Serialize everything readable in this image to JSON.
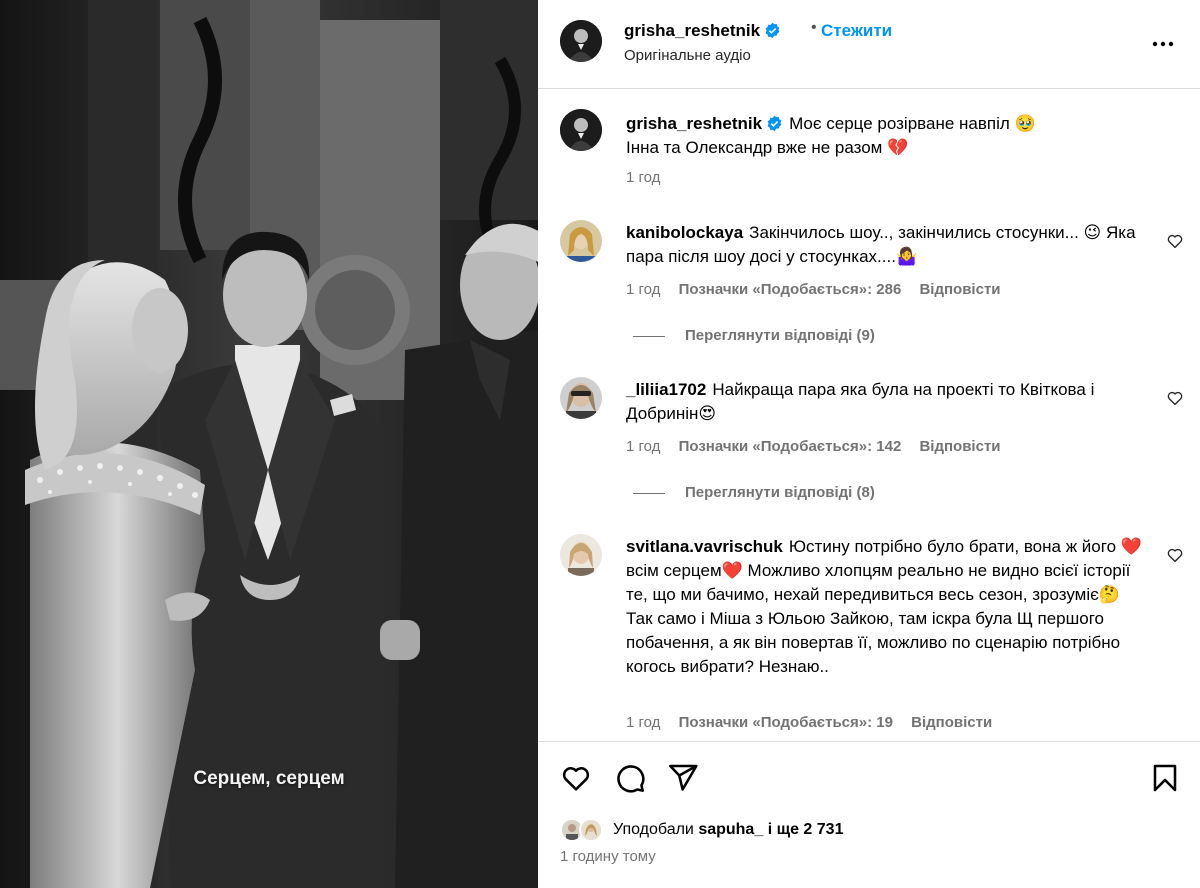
{
  "video": {
    "caption": "Серцем, серцем"
  },
  "header": {
    "username": "grisha_reshetnik",
    "separator": "•",
    "follow_label": "Стежити",
    "audio": "Оригінальне аудіо",
    "more_icon": "more-options-icon"
  },
  "post": {
    "username": "grisha_reshetnik",
    "text_line1": "Моє серце розірване навпіл 🥹",
    "text_line2": "Інна та Олександр вже не разом 💔",
    "time": "1 год"
  },
  "comments": [
    {
      "username": "kanibolockaya",
      "text": "Закінчилось шоу.., закінчились стосунки... 😉 Яка пара після шоу досі у стосунках....🤷‍♀️",
      "time": "1 год",
      "likes": "Позначки «Подобається»: 286",
      "reply": "Відповісти",
      "view_replies": "Переглянути відповіді (9)"
    },
    {
      "username": "_liliia1702",
      "text": "Найкраща пара яка була на проекті то Квіткова і Добринін😍",
      "time": "1 год",
      "likes": "Позначки «Подобається»: 142",
      "reply": "Відповісти",
      "view_replies": "Переглянути відповіді (8)"
    },
    {
      "username": "svitlana.vavrischuk",
      "text": "Юстину потрібно було брати, вона ж його ❤️всім серцем❤️ Можливо хлопцям реально не видно всієї історії те, що ми бачимо, нехай передивиться весь сезон, зрозуміє🤔 Так само і Міша з Юльою Зайкою, там іскра була Щ першого побачення, а як він повертав її, можливо по сценарію потрібно когось вибрати? Незнаю..",
      "time": "1 год",
      "likes": "Позначки «Подобається»: 19",
      "reply": "Відповісти"
    }
  ],
  "actions": {
    "like_icon": "heart-icon",
    "comment_icon": "comment-icon",
    "share_icon": "share-icon",
    "save_icon": "bookmark-icon"
  },
  "likes": {
    "prefix": "Уподобали",
    "user": "sapuha_",
    "suffix": "і ще 2 731"
  },
  "posted": "1 годину тому",
  "colors": {
    "accent": "#0095f6",
    "verified": "#0095f6",
    "muted": "#737373",
    "divider": "#dbdbdb"
  }
}
